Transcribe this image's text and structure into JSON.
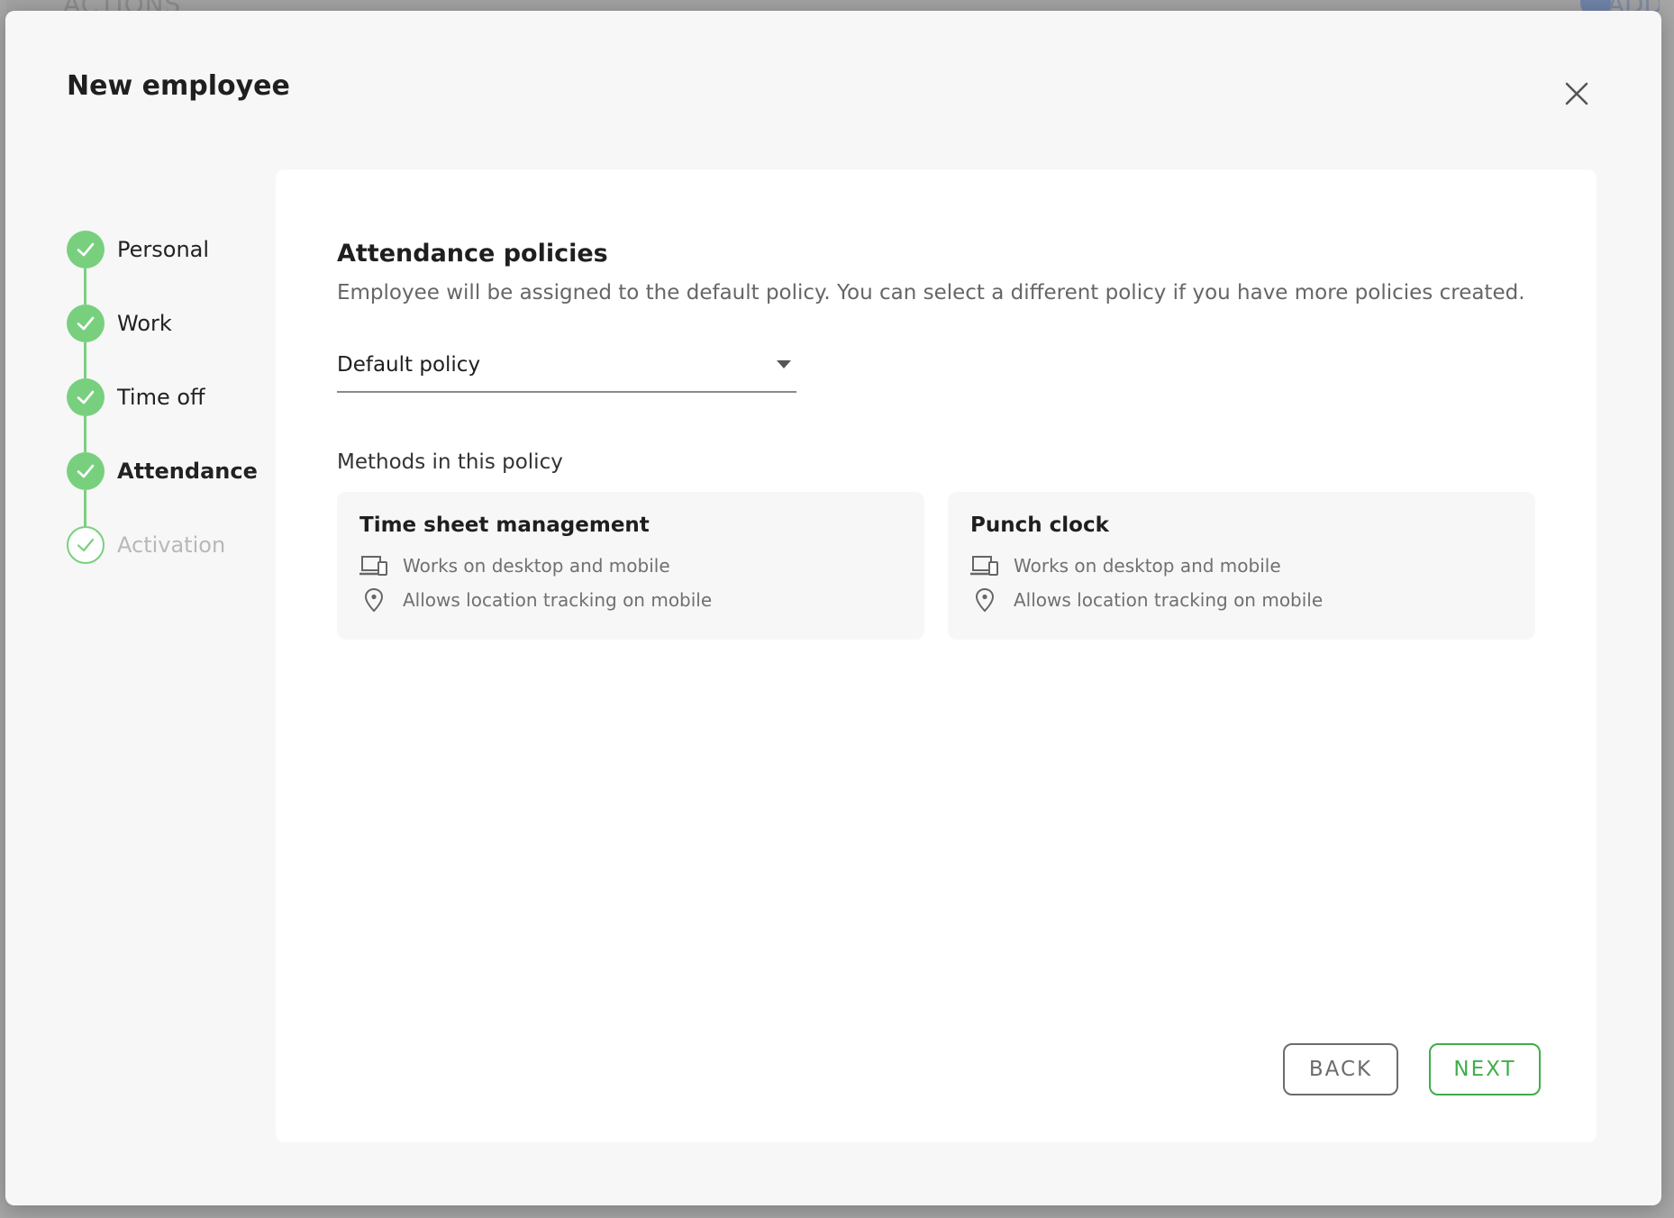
{
  "background": {
    "actions_label": "ACTIONS",
    "add_label": "ADD"
  },
  "modal": {
    "title": "New employee",
    "close_icon": "close-icon"
  },
  "stepper": {
    "steps": [
      {
        "label": "Personal",
        "state": "completed"
      },
      {
        "label": "Work",
        "state": "completed"
      },
      {
        "label": "Time off",
        "state": "completed"
      },
      {
        "label": "Attendance",
        "state": "current"
      },
      {
        "label": "Activation",
        "state": "upcoming"
      }
    ]
  },
  "content": {
    "title": "Attendance policies",
    "description": "Employee will be assigned to the default policy. You can select a different policy if you have more policies created.",
    "policy_select": {
      "value": "Default policy"
    },
    "methods_label": "Methods in this policy",
    "methods": [
      {
        "title": "Time sheet management",
        "features": [
          {
            "icon": "devices-icon",
            "text": "Works on desktop and mobile"
          },
          {
            "icon": "location-pin-icon",
            "text": "Allows location tracking on mobile"
          }
        ]
      },
      {
        "title": "Punch clock",
        "features": [
          {
            "icon": "devices-icon",
            "text": "Works on desktop and mobile"
          },
          {
            "icon": "location-pin-icon",
            "text": "Allows location tracking on mobile"
          }
        ]
      }
    ]
  },
  "actions": {
    "back_label": "BACK",
    "next_label": "NEXT"
  },
  "colors": {
    "step_green": "#78d07f",
    "next_green": "#3fae4a",
    "back_gray": "#6c6c6c",
    "modal_bg": "#f7f7f7",
    "card_bg": "#ffffff"
  }
}
